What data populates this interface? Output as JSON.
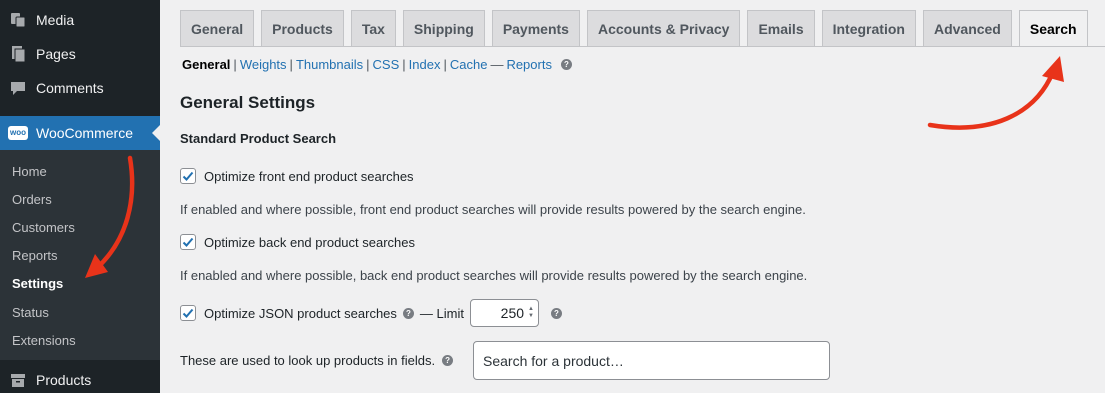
{
  "sidebar": {
    "top_items": [
      {
        "label": "Media",
        "icon": "media-icon"
      },
      {
        "label": "Pages",
        "icon": "pages-icon"
      },
      {
        "label": "Comments",
        "icon": "comments-icon"
      },
      {
        "label": "WooCommerce",
        "icon": "woocommerce-icon",
        "badge": "woo"
      }
    ],
    "sub_items": [
      "Home",
      "Orders",
      "Customers",
      "Reports",
      "Settings",
      "Status",
      "Extensions"
    ],
    "bottom_item": {
      "label": "Products",
      "icon": "products-icon"
    }
  },
  "tabs": [
    "General",
    "Products",
    "Tax",
    "Shipping",
    "Payments",
    "Accounts & Privacy",
    "Emails",
    "Integration",
    "Advanced",
    "Search"
  ],
  "active_tab": "Search",
  "subnav": {
    "current": "General",
    "links": [
      "Weights",
      "Thumbnails",
      "CSS",
      "Index",
      "Cache",
      "Reports"
    ],
    "separator": "|",
    "dash": "—"
  },
  "page": {
    "title": "General Settings",
    "section": "Standard Product Search",
    "front_end": {
      "label": "Optimize front end product searches",
      "checked": true,
      "description": "If enabled and where possible, front end product searches will provide results powered by the search engine."
    },
    "back_end": {
      "label": "Optimize back end product searches",
      "checked": true,
      "description": "If enabled and where possible, back end product searches will provide results powered by the search engine."
    },
    "json": {
      "label": "Optimize JSON product searches",
      "checked": true,
      "limit_label": "— Limit",
      "limit_value": "250"
    },
    "fields": {
      "label": "These are used to look up products in fields.",
      "placeholder": "Search for a product…"
    },
    "help_glyph": "?"
  },
  "colors": {
    "sidebar_bg": "#1d2327",
    "submenu_bg": "#2c3338",
    "accent": "#2271b1",
    "arrow": "#e8331a"
  }
}
